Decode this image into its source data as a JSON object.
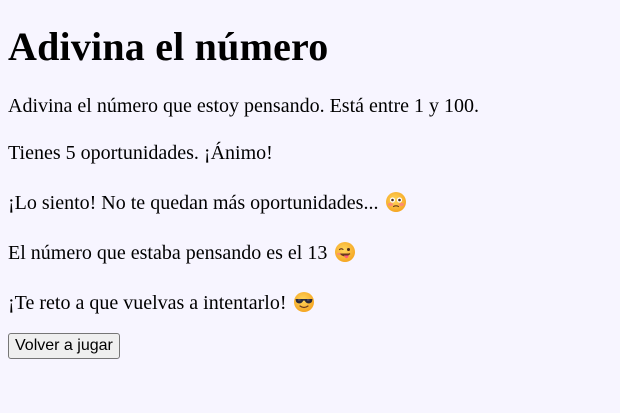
{
  "game": {
    "title": "Adivina el número",
    "instructions": "Adivina el número que estoy pensando. Está entre 1 y 100.",
    "attempts": "Tienes 5 oportunidades. ¡Ánimo!",
    "lose_message": "¡Lo siento! No te quedan más oportunidades...",
    "lose_emoji": "flushed-face-icon",
    "reveal_message": "El número que estaba pensando es el 13",
    "reveal_emoji": "winking-tongue-face-icon",
    "retry_message": "¡Te reto a que vuelvas a intentarlo!",
    "retry_emoji": "sunglasses-face-icon",
    "play_again_label": "Volver a jugar"
  },
  "colors": {
    "background": "#f7f5ff",
    "emoji_face": "#ffc83d",
    "button_bg": "#efefef",
    "button_border": "#767676"
  }
}
